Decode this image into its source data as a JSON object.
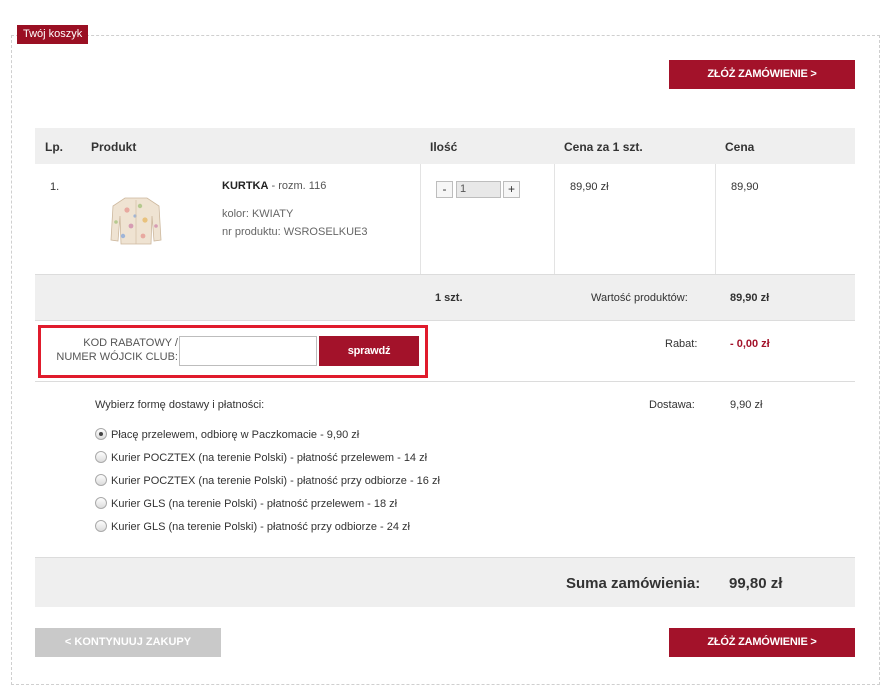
{
  "cart": {
    "tab_label": "Twój koszyk"
  },
  "buttons": {
    "checkout_top": "ZŁÓŻ ZAMÓWIENIE >",
    "checkout_bottom": "ZŁÓŻ ZAMÓWIENIE >",
    "continue_shopping": "< KONTYNUUJ ZAKUPY",
    "check_code": "sprawdź"
  },
  "table": {
    "headers": {
      "lp": "Lp.",
      "product": "Produkt",
      "qty": "Ilość",
      "unit_price": "Cena za 1 szt.",
      "price": "Cena"
    },
    "rows": [
      {
        "lp": "1.",
        "name": "KURTKA",
        "size": " - rozm. 116",
        "color": "kolor: KWIATY",
        "product_no": "nr produktu: WSROSELKUE3",
        "qty_minus": "-",
        "qty": "1",
        "qty_plus": "+",
        "unit_price": "89,90 zł",
        "price": "89,90",
        "image_icon": "flowered-jacket-image"
      }
    ]
  },
  "summary": {
    "qty_total": "1 szt.",
    "products_value_label": "Wartość produktów:",
    "products_value": "89,90 zł",
    "discount_label": "Rabat:",
    "discount_value": "- 0,00 zł",
    "delivery_label": "Dostawa:",
    "delivery_value": "9,90 zł",
    "total_label": "Suma zamówienia:",
    "total_value": "99,80 zł"
  },
  "promo": {
    "label_line1": "KOD RABATOWY /",
    "label_line2": "NUMER WÓJCIK CLUB:",
    "input_value": ""
  },
  "shipping": {
    "title": "Wybierz formę dostawy i płatności:",
    "options": [
      {
        "label": "Płacę przelewem, odbiorę w Paczkomacie - 9,90 zł",
        "checked": true
      },
      {
        "label": "Kurier POCZTEX (na terenie Polski) - płatność przelewem - 14 zł",
        "checked": false
      },
      {
        "label": "Kurier POCZTEX (na terenie Polski) - płatność przy odbiorze - 16 zł",
        "checked": false
      },
      {
        "label": "Kurier GLS (na terenie Polski) - płatność przelewem - 18 zł",
        "checked": false
      },
      {
        "label": "Kurier GLS (na terenie Polski) - płatność przy odbiorze - 24 zł",
        "checked": false
      }
    ]
  },
  "colors": {
    "accent": "#a3122a",
    "highlight": "#e01b2c",
    "discount": "#a3122a"
  }
}
